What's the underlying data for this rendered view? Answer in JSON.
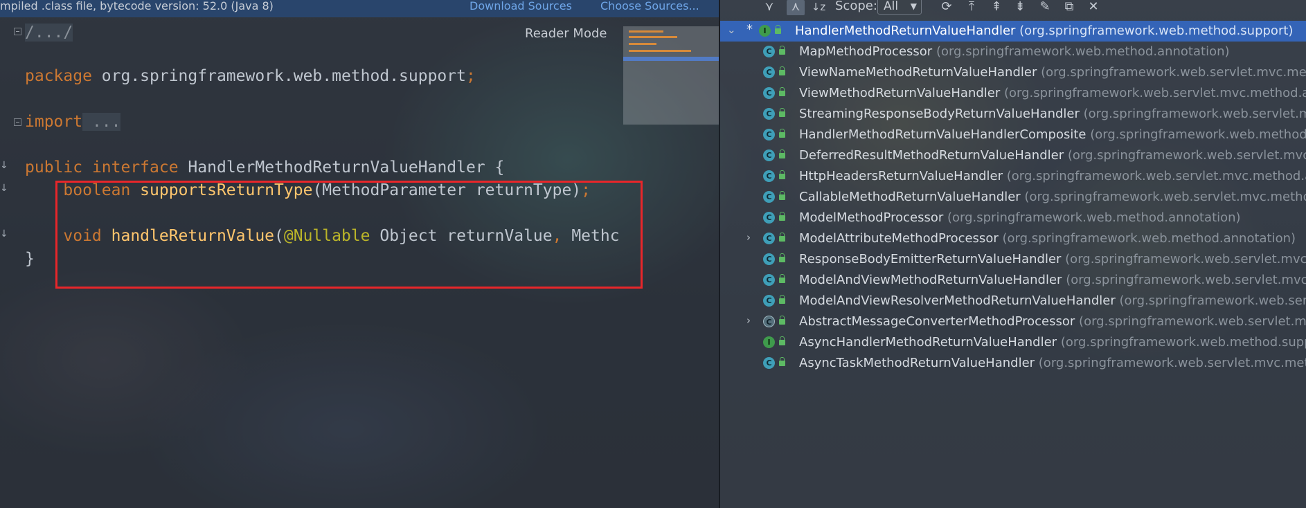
{
  "editor": {
    "banner": {
      "message": "mpiled .class file, bytecode version: 52.0 (Java 8)",
      "download_sources": "Download Sources",
      "choose_sources": "Choose Sources..."
    },
    "reader_mode": "Reader Mode",
    "code": {
      "header_comment": "/.../",
      "package_kw": "package",
      "package_name": " org.springframework.web.method.support",
      "semicolon": ";",
      "import_kw": "import",
      "import_fold": " ...",
      "iface_kw1": "public",
      "iface_kw2": " interface",
      "iface_name": " HandlerMethodReturnValueHandler {",
      "m1_type": "boolean",
      "m1_name": " supportsReturnType",
      "m1_params": "(MethodParameter returnType)",
      "m1_end": ";",
      "m2_type": "void",
      "m2_name": " handleReturnValue",
      "m2_open": "(",
      "m2_annotation": "@Nullable",
      "m2_params": " Object returnValue",
      "m2_comma": ",",
      "m2_rest": " Methc",
      "closing_brace": "}"
    }
  },
  "hierarchy": {
    "toolbar": {
      "scope_label": "Scope:",
      "scope_value": "All",
      "icons": [
        "supertypes-hierarchy-icon",
        "subtypes-hierarchy-icon",
        "sort-alphabetically-icon",
        "refresh-icon",
        "export-to-text-icon",
        "expand-all-icon",
        "collapse-all-icon",
        "pin-icon",
        "open-in-window-icon",
        "close-icon"
      ]
    },
    "tree": [
      {
        "kind": "interface",
        "name": "HandlerMethodReturnValueHandler",
        "pkg": "(org.springframework.web.method.support)",
        "selected": true,
        "expandable": true,
        "expanded": true,
        "root": true
      },
      {
        "kind": "class",
        "name": "MapMethodProcessor",
        "pkg": "(org.springframework.web.method.annotation)"
      },
      {
        "kind": "class",
        "name": "ViewNameMethodReturnValueHandler",
        "pkg": "(org.springframework.web.servlet.mvc.metho"
      },
      {
        "kind": "class",
        "name": "ViewMethodReturnValueHandler",
        "pkg": "(org.springframework.web.servlet.mvc.method.anno"
      },
      {
        "kind": "class",
        "name": "StreamingResponseBodyReturnValueHandler",
        "pkg": "(org.springframework.web.servlet.mvc."
      },
      {
        "kind": "class",
        "name": "HandlerMethodReturnValueHandlerComposite",
        "pkg": "(org.springframework.web.method.su"
      },
      {
        "kind": "class",
        "name": "DeferredResultMethodReturnValueHandler",
        "pkg": "(org.springframework.web.servlet.mvc.me"
      },
      {
        "kind": "class",
        "name": "HttpHeadersReturnValueHandler",
        "pkg": "(org.springframework.web.servlet.mvc.method.ann"
      },
      {
        "kind": "class",
        "name": "CallableMethodReturnValueHandler",
        "pkg": "(org.springframework.web.servlet.mvc.method.a"
      },
      {
        "kind": "class",
        "name": "ModelMethodProcessor",
        "pkg": "(org.springframework.web.method.annotation)"
      },
      {
        "kind": "class",
        "name": "ModelAttributeMethodProcessor",
        "pkg": "(org.springframework.web.method.annotation)",
        "expandable": true
      },
      {
        "kind": "class",
        "name": "ResponseBodyEmitterReturnValueHandler",
        "pkg": "(org.springframework.web.servlet.mvc.me"
      },
      {
        "kind": "class",
        "name": "ModelAndViewMethodReturnValueHandler",
        "pkg": "(org.springframework.web.servlet.mvc.m"
      },
      {
        "kind": "class",
        "name": "ModelAndViewResolverMethodReturnValueHandler",
        "pkg": "(org.springframework.web.servle"
      },
      {
        "kind": "abstract",
        "name": "AbstractMessageConverterMethodProcessor",
        "pkg": "(org.springframework.web.servlet.mvc.m",
        "expandable": true
      },
      {
        "kind": "interface",
        "name": "AsyncHandlerMethodReturnValueHandler",
        "pkg": "(org.springframework.web.method.suppo"
      },
      {
        "kind": "class",
        "name": "AsyncTaskMethodReturnValueHandler",
        "pkg": "(org.springframework.web.servlet.mvc.metho"
      }
    ]
  },
  "colors": {
    "highlight_box": "#e8262a",
    "selection": "#3466be",
    "keyword": "#cc7832",
    "method_name": "#ffc66d",
    "annotation": "#bbb529",
    "link": "#6fa6e8"
  }
}
